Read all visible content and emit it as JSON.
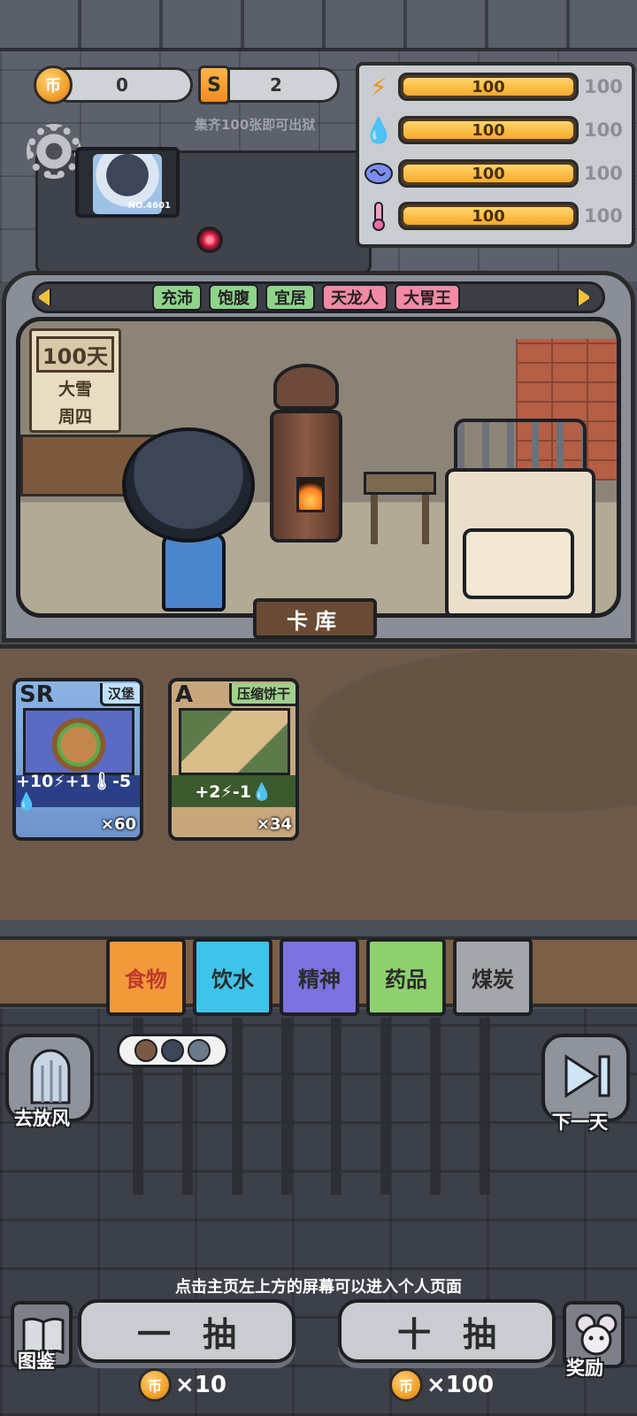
{
  "currency": {
    "coins": "0",
    "tickets": "2",
    "coin_symbol": "币",
    "ticket_symbol": "S",
    "ticket_hint": "集齐100张即可出狱"
  },
  "profile": {
    "number": "NO.4601"
  },
  "stats": [
    {
      "icon": "lightning-icon",
      "value": "100",
      "max": "100",
      "fill": 1.0,
      "color": "#f08d1e"
    },
    {
      "icon": "water-drop-icon",
      "value": "100",
      "max": "100",
      "fill": 1.0,
      "color": "#3ba7ea"
    },
    {
      "icon": "brain-icon",
      "value": "100",
      "max": "100",
      "fill": 1.0,
      "color": "#6a79e0"
    },
    {
      "icon": "thermometer-icon",
      "value": "100",
      "max": "100",
      "fill": 1.0,
      "color": "#f06aa8"
    }
  ],
  "tags": [
    {
      "label": "充沛",
      "color": "#8fd48a"
    },
    {
      "label": "饱腹",
      "color": "#8fd48a"
    },
    {
      "label": "宜居",
      "color": "#8fd48a"
    },
    {
      "label": "天龙人",
      "color": "#f38aa5"
    },
    {
      "label": "大胃王",
      "color": "#f38aa5"
    }
  ],
  "calendar": {
    "days": "100天",
    "weather": "大雪",
    "weekday": "周四"
  },
  "room_label": "卡库",
  "cards": [
    {
      "rank": "SR",
      "name": "汉堡",
      "effects": "+10⚡+1🌡-5💧",
      "count": "×60",
      "name_bg": "#bfe0ff",
      "effect_bg": "#2c3f86"
    },
    {
      "rank": "A",
      "name": "压缩饼干",
      "effects": "+2⚡-1💧",
      "count": "×34",
      "name_bg": "#9fd18c",
      "effect_bg": "#3b5a2d"
    }
  ],
  "categories": [
    {
      "label": "食物",
      "bg": "#f29a3a",
      "active": true
    },
    {
      "label": "饮水",
      "bg": "#3ec4ea",
      "active": false
    },
    {
      "label": "精神",
      "bg": "#7b72e0",
      "active": false
    },
    {
      "label": "药品",
      "bg": "#8fd06e",
      "active": false
    },
    {
      "label": "煤炭",
      "bg": "#a4a6ab",
      "active": false
    }
  ],
  "buttons": {
    "go_out": "去放风",
    "next_day": "下一天",
    "codex": "图鉴",
    "reward": "奖励",
    "draw_one": "一抽",
    "draw_ten": "十抽",
    "draw_one_cost": "×10",
    "draw_ten_cost": "×100"
  },
  "tip": "点击主页左上方的屏幕可以进入个人页面"
}
